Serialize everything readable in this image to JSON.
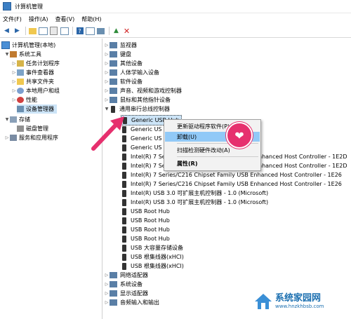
{
  "window": {
    "title": "计算机管理"
  },
  "menu": [
    "文件(F)",
    "操作(A)",
    "查看(V)",
    "帮助(H)"
  ],
  "left_tree": [
    {
      "label": "计算机管理(本地)",
      "icon": "computer-icon"
    },
    {
      "label": "系统工具",
      "icon": "tools-icon"
    },
    {
      "label": "任务计划程序",
      "icon": "task-scheduler-icon"
    },
    {
      "label": "事件查看器",
      "icon": "event-viewer-icon"
    },
    {
      "label": "共享文件夹",
      "icon": "shared-folder-icon"
    },
    {
      "label": "本地用户和组",
      "icon": "users-icon"
    },
    {
      "label": "性能",
      "icon": "performance-icon"
    },
    {
      "label": "设备管理器",
      "icon": "device-manager-icon"
    },
    {
      "label": "存储",
      "icon": "storage-icon"
    },
    {
      "label": "磁盘管理",
      "icon": "disk-icon"
    },
    {
      "label": "服务和应用程序",
      "icon": "services-icon"
    }
  ],
  "device_tree": [
    {
      "label": "监视器"
    },
    {
      "label": "键盘"
    },
    {
      "label": "其他设备"
    },
    {
      "label": "人体学输入设备"
    },
    {
      "label": "软件设备"
    },
    {
      "label": "声音、视频和游戏控制器"
    },
    {
      "label": "鼠标和其他指针设备"
    },
    {
      "label": "通用串行总线控制器"
    },
    {
      "label": "Generic USB Hub"
    },
    {
      "label": "Generic US"
    },
    {
      "label": "Generic US"
    },
    {
      "label": "Generic US"
    },
    {
      "label": "Intel(R) 7 Se"
    },
    {
      "label": "Intel(R) 7 Se"
    },
    {
      "label": "Intel(R) 7 Series/C216 Chipset Family USB Enhanced Host Controller - 1E26"
    },
    {
      "label": "Intel(R) 7 Series/C216 Chipset Family USB Enhanced Host Controller - 1E26"
    },
    {
      "label": "Intel(R) USB 3.0 可扩展主机控制器 - 1.0 (Microsoft)"
    },
    {
      "label": "Intel(R) USB 3.0 可扩展主机控制器 - 1.0 (Microsoft)"
    },
    {
      "label": "USB Root Hub"
    },
    {
      "label": "USB Root Hub"
    },
    {
      "label": "USB Root Hub"
    },
    {
      "label": "USB Root Hub"
    },
    {
      "label": "USB 大容量存储设备"
    },
    {
      "label": "USB 根集线器(xHCI)"
    },
    {
      "label": "USB 根集线器(xHCI)"
    },
    {
      "label": "网络适配器"
    },
    {
      "label": "系统设备"
    },
    {
      "label": "显示适配器"
    },
    {
      "label": "音频输入和输出"
    }
  ],
  "partial_tails": {
    "row12": "nhanced Host Controller - 1E2D",
    "row13": "nhanced Host Controller - 1E2D"
  },
  "context_menu": {
    "update_driver": "更新驱动程序软件(P)...",
    "uninstall": "卸载(U)",
    "scan": "扫描检测硬件改动(A)",
    "properties": "属性(R)"
  },
  "watermark": {
    "name": "系统家园网",
    "url": "www.hnzkhbsb.com"
  },
  "colors": {
    "accent": "#e6306e",
    "selection": "#cce4f7",
    "menu_highlight": "#91c9f7"
  }
}
